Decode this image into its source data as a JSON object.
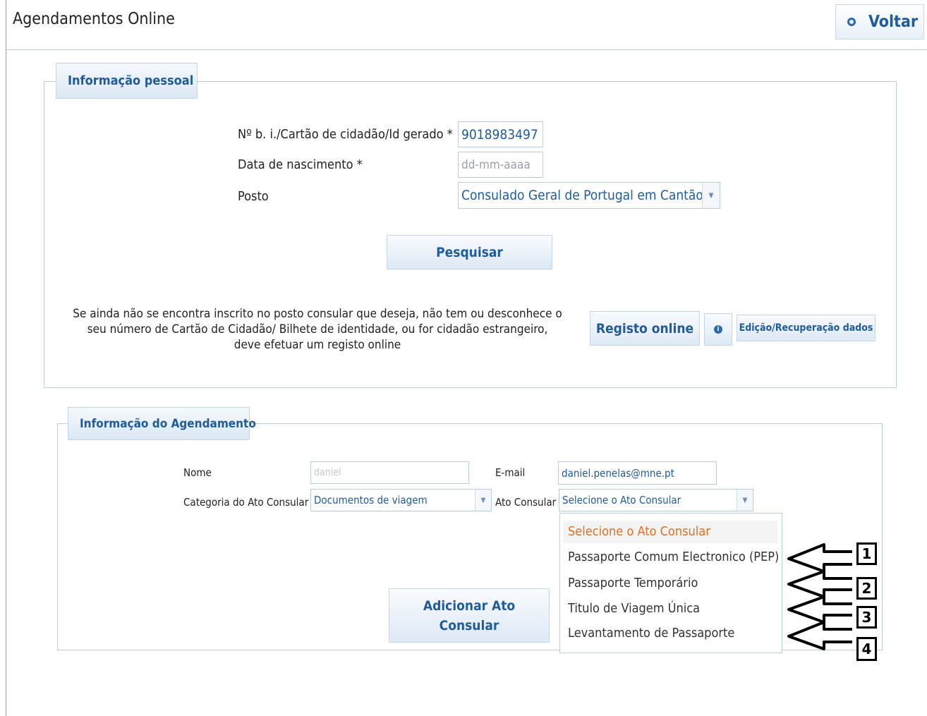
{
  "header": {
    "title": "Agendamentos Online",
    "back_label": "Voltar"
  },
  "personal": {
    "legend": "Informação pessoal",
    "id_label": "Nº b. i./Cartão de cidadão/Id gerado *",
    "id_value": "9018983497",
    "dob_label": "Data de nascimento *",
    "dob_placeholder": "dd-mm-aaaa",
    "posto_label": "Posto",
    "posto_value": "Consulado Geral de Portugal em Cantão",
    "search_button": "Pesquisar",
    "register_info_lines": [
      "Se ainda não se encontra inscrito no posto consular que deseja, não tem ou desconhece o",
      "seu número de Cartão de Cidadão/ Bilhete de identidade, ou for cidadão estrangeiro,",
      "deve efetuar um registo online"
    ],
    "register_button": "Registo online",
    "edit_button": "Edição/Recuperação dados"
  },
  "appointment": {
    "legend": "Informação do Agendamento",
    "name_label": "Nome",
    "name_value": "daniel",
    "email_label": "E-mail",
    "email_value": "daniel.penelas@mne.pt",
    "category_label": "Categoria do Ato Consular",
    "category_value": "Documentos de viagem",
    "act_label": "Ato Consular",
    "act_value": "Selecione o Ato Consular",
    "add_button_line1": "Adicionar Ato",
    "add_button_line2": "Consular",
    "dropdown_options": [
      "Selecione o Ato Consular",
      "Passaporte Comum Electronico (PEP)",
      "Passaporte Temporário",
      "Titulo de Viagem Única",
      "Levantamento de Passaporte"
    ],
    "selected_option_index": 0
  },
  "annotations": [
    "1",
    "2",
    "3",
    "4"
  ],
  "colors": {
    "accent_text": "#1f5c99",
    "selected_option": "#e07020",
    "border": "#b8cde0"
  }
}
